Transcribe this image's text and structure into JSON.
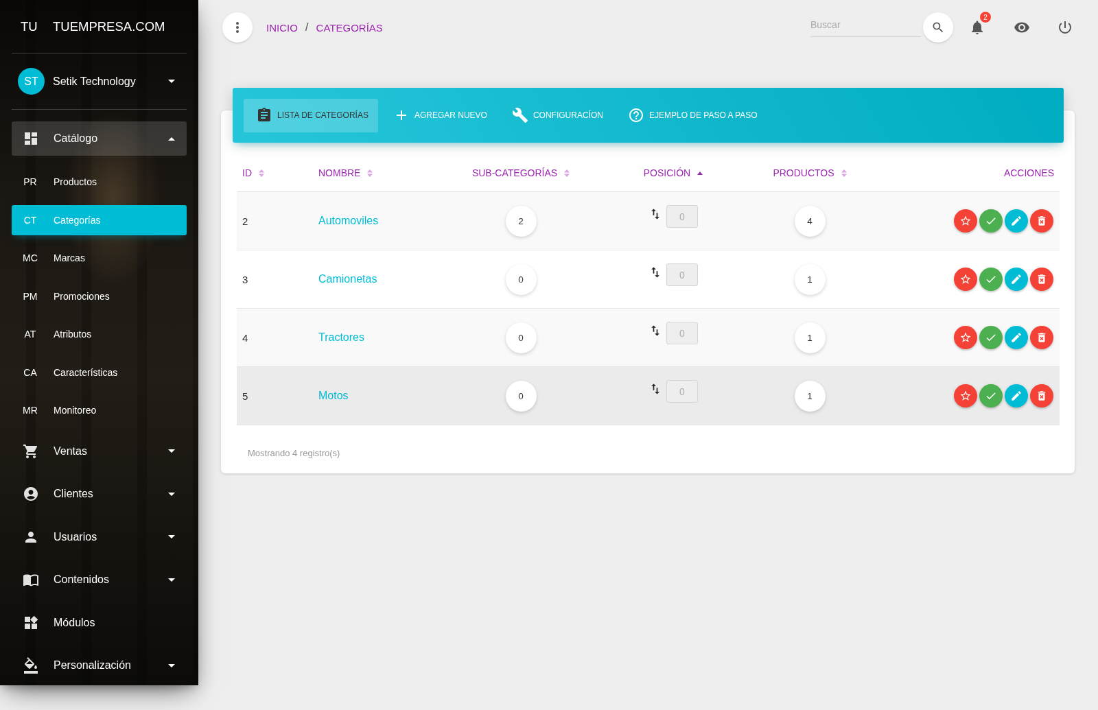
{
  "sidebar": {
    "logo": {
      "mini": "TU",
      "name": "TUEMPRESA.COM"
    },
    "user": {
      "initials": "ST",
      "name": "Setik Technology",
      "expanded": false
    },
    "items": [
      {
        "kind": "menu",
        "label": "Catálogo",
        "expanded": true,
        "children": [
          {
            "abbr": "PR",
            "label": "Productos",
            "selected": false
          },
          {
            "abbr": "CT",
            "label": "Categorías",
            "selected": true
          },
          {
            "abbr": "MC",
            "label": "Marcas",
            "selected": false
          },
          {
            "abbr": "PM",
            "label": "Promociones",
            "selected": false
          },
          {
            "abbr": "AT",
            "label": "Atributos",
            "selected": false
          },
          {
            "abbr": "CA",
            "label": "Características",
            "selected": false
          },
          {
            "abbr": "MR",
            "label": "Monitoreo",
            "selected": false
          }
        ]
      },
      {
        "kind": "menu",
        "label": "Ventas",
        "expanded": false
      },
      {
        "kind": "menu",
        "label": "Clientes",
        "expanded": false
      },
      {
        "kind": "menu",
        "label": "Usuarios",
        "expanded": false
      },
      {
        "kind": "menu",
        "label": "Contenidos",
        "expanded": false
      },
      {
        "kind": "link",
        "label": "Módulos"
      },
      {
        "kind": "menu",
        "label": "Personalización",
        "expanded": false
      }
    ]
  },
  "topbar": {
    "breadcrumb": [
      {
        "label": "INICIO"
      },
      {
        "label": "CATEGORÍAS"
      }
    ],
    "separator": "/",
    "search": {
      "placeholder": "Buscar"
    },
    "notifications": "2"
  },
  "card": {
    "tabs": [
      {
        "label": "LISTA DE CATEGORÍAS",
        "selected": true
      },
      {
        "label": "AGREGAR NUEVO",
        "selected": false
      },
      {
        "label": "CONFIGURACÍON",
        "selected": false
      },
      {
        "label": "EJEMPLO DE PASO A PASO",
        "selected": false
      }
    ],
    "table": {
      "columns": [
        {
          "label": "ID",
          "sortable": true,
          "sorted": false
        },
        {
          "label": "NOMBRE",
          "sortable": true,
          "sorted": false
        },
        {
          "label": "SUB-CATEGORÍAS",
          "sortable": true,
          "sorted": false
        },
        {
          "label": "POSICIÓN",
          "sortable": true,
          "sorted": true
        },
        {
          "label": "PRODUCTOS",
          "sortable": true,
          "sorted": false
        },
        {
          "label": "ACCIONES",
          "sortable": false,
          "sorted": false
        }
      ],
      "rows": [
        {
          "id": "2",
          "name": "Automoviles",
          "subcategories": "2",
          "position": {
            "value": "0",
            "disabled": true
          },
          "products": "4",
          "highlighted": false
        },
        {
          "id": "3",
          "name": "Camionetas",
          "subcategories": "0",
          "position": {
            "value": "0",
            "disabled": true
          },
          "products": "1",
          "highlighted": false
        },
        {
          "id": "4",
          "name": "Tractores",
          "subcategories": "0",
          "position": {
            "value": "0",
            "disabled": true
          },
          "products": "1",
          "highlighted": false
        },
        {
          "id": "5",
          "name": "Motos",
          "subcategories": "0",
          "position": {
            "value": "0",
            "disabled": true
          },
          "products": "1",
          "highlighted": true
        }
      ]
    },
    "footer": "Mostrando 4 registro(s)"
  }
}
